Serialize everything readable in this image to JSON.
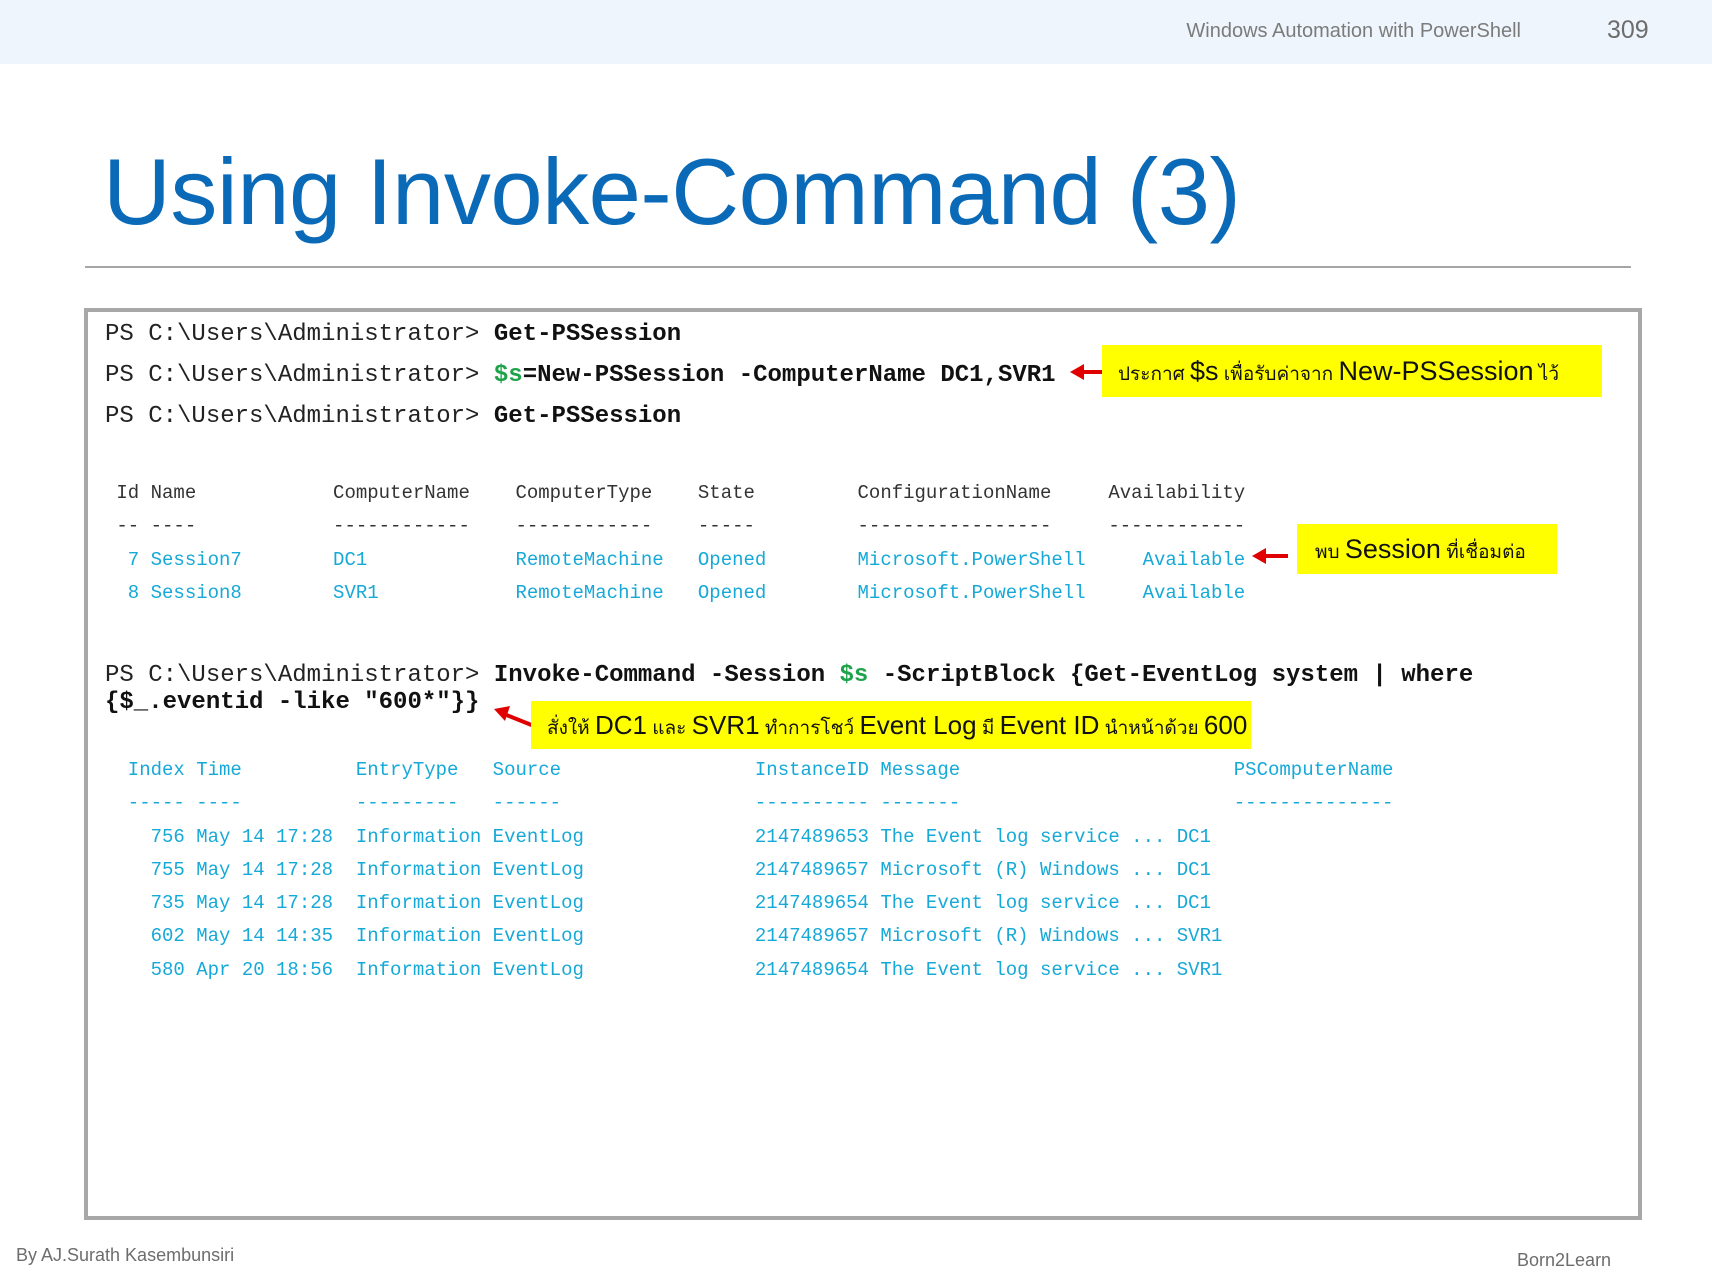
{
  "header": {
    "course_title": "Windows Automation with PowerShell",
    "page_number": "309"
  },
  "slide": {
    "title": "Using Invoke-Command (3)"
  },
  "console": {
    "prompt": "PS C:\\Users\\Administrator>",
    "commands": {
      "c1": "Get-PSSession",
      "c2_var": "$s",
      "c2_rest": "=New-PSSession -ComputerName DC1,SVR1",
      "c3": "Get-PSSession",
      "c4_a": "Invoke-Command -Session ",
      "c4_var": "$s",
      "c4_b": " -ScriptBlock {Get-EventLog system | where",
      "c4_cont": "{$_.eventid -like \"600*\"}}"
    },
    "sessions_table": {
      "header": " Id Name            ComputerName    ComputerType    State         ConfigurationName     Availability",
      "divider": " -- ----            ------------    ------------    -----         -----------------     ------------",
      "rows": [
        "  7 Session7        DC1             RemoteMachine   Opened        Microsoft.PowerShell     Available",
        "  8 Session8        SVR1            RemoteMachine   Opened        Microsoft.PowerShell     Available"
      ]
    },
    "events_table": {
      "header": "  Index Time          EntryType   Source                 InstanceID Message                        PSComputerName",
      "divider": "  ----- ----          ---------   ------                 ---------- -------                        --------------",
      "rows": [
        "    756 May 14 17:28  Information EventLog               2147489653 The Event log service ... DC1",
        "    755 May 14 17:28  Information EventLog               2147489657 Microsoft (R) Windows ... DC1",
        "    735 May 14 17:28  Information EventLog               2147489654 The Event log service ... DC1",
        "    602 May 14 14:35  Information EventLog               2147489657 Microsoft (R) Windows ... SVR1",
        "    580 Apr 20 18:56  Information EventLog               2147489654 The Event log service ... SVR1"
      ]
    }
  },
  "callouts": {
    "c1": {
      "p1": "ประกาศ ",
      "p2": "$s",
      "p3": " เพื่อรับค่าจาก ",
      "p4": "New-PSSession",
      "p5": " ไว้"
    },
    "c2": {
      "p1": "พบ ",
      "p2": "Session",
      "p3": " ที่เชื่อมต่อ"
    },
    "c3": {
      "p1": "สั่งให้ ",
      "p2": "DC1",
      "p3": " และ ",
      "p4": "SVR1",
      "p5": " ทำการโชว์ ",
      "p6": "Event Log",
      "p7": " มี ",
      "p8": "Event ID",
      "p9": " นำหน้าด้วย ",
      "p10": "600"
    }
  },
  "colors": {
    "title": "#0a6ab8",
    "output_text": "#16a9d8",
    "variable": "#1ea24a",
    "callout_bg": "#ffff00",
    "arrow": "#e00000"
  },
  "footer": {
    "author": "By AJ.Surath Kasembunsiri",
    "brand": "Born2Learn"
  }
}
